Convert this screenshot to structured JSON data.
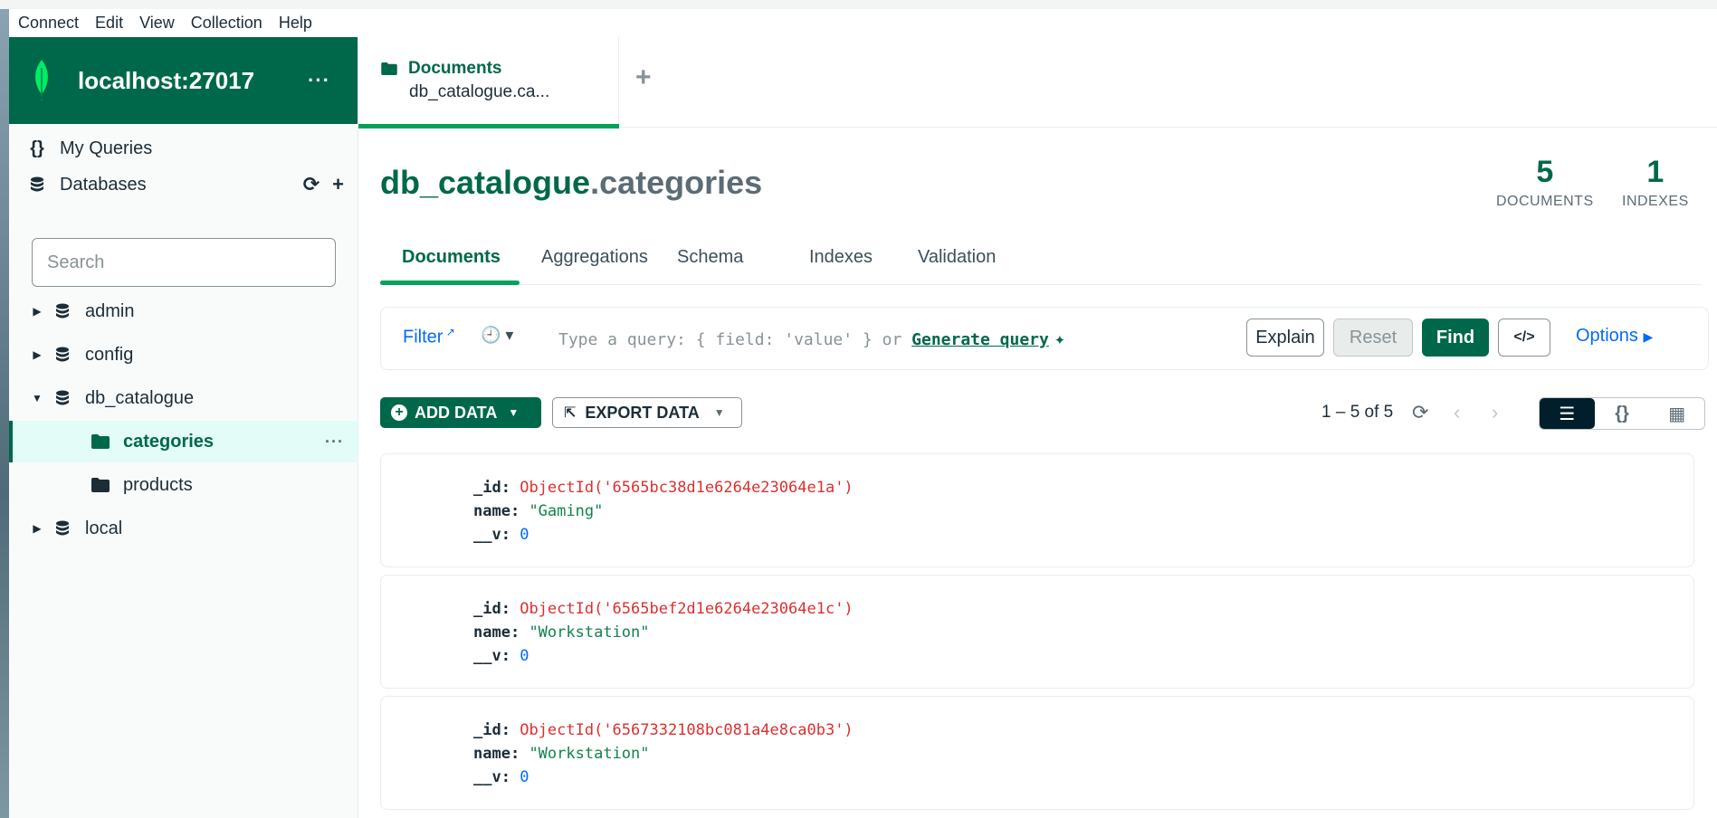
{
  "menubar": [
    "Connect",
    "Edit",
    "View",
    "Collection",
    "Help"
  ],
  "sidebar": {
    "connection": "localhost:27017",
    "more": "···",
    "my_queries": "My Queries",
    "databases": "Databases",
    "search_placeholder": "Search",
    "dbs": [
      {
        "name": "admin",
        "expanded": false
      },
      {
        "name": "config",
        "expanded": false
      },
      {
        "name": "db_catalogue",
        "expanded": true,
        "collections": [
          "categories",
          "products"
        ]
      },
      {
        "name": "local",
        "expanded": false
      }
    ],
    "active_collection": "categories"
  },
  "workspace_tab": {
    "title": "Documents",
    "subtitle": "db_catalogue.ca..."
  },
  "collection": {
    "db": "db_catalogue",
    "dot_name": ".categories",
    "documents_count": "5",
    "documents_label": "DOCUMENTS",
    "indexes_count": "1",
    "indexes_label": "INDEXES"
  },
  "subtabs": [
    "Documents",
    "Aggregations",
    "Schema",
    "Indexes",
    "Validation"
  ],
  "query": {
    "filter_label": "Filter",
    "placeholder_prefix": "Type a query: { field: 'value' } or ",
    "generate_label": "Generate query",
    "explain": "Explain",
    "reset": "Reset",
    "find": "Find",
    "code": "</>",
    "options": "Options"
  },
  "toolbar": {
    "add_data": "ADD DATA",
    "export_data": "EXPORT DATA",
    "pager": "1 – 5 of 5"
  },
  "documents": [
    {
      "id": "ObjectId('6565bc38d1e6264e23064e1a')",
      "name": "\"Gaming\"",
      "v": "0"
    },
    {
      "id": "ObjectId('6565bef2d1e6264e23064e1c')",
      "name": "\"Workstation\"",
      "v": "0"
    },
    {
      "id": "ObjectId('6567332108bc081a4e8ca0b3')",
      "name": "\"Workstation\"",
      "v": "0"
    }
  ],
  "keys": {
    "id": "_id:",
    "name": "name:",
    "v": "__v:"
  }
}
